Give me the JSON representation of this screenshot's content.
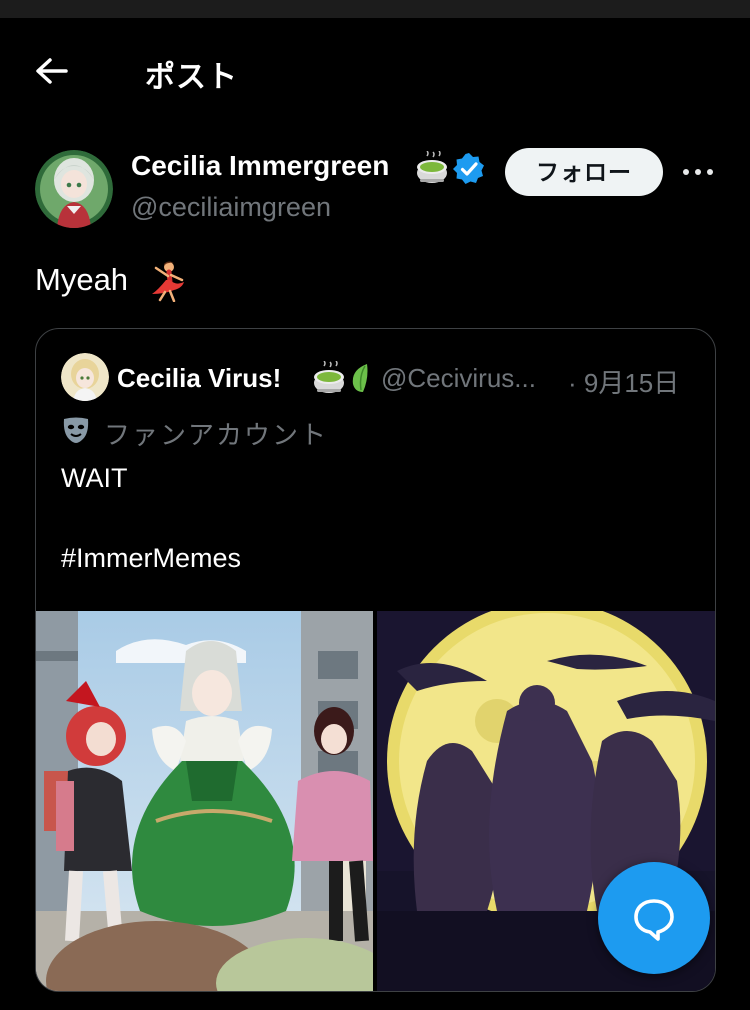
{
  "header": {
    "title": "ポスト",
    "back_icon": "arrow-left-icon"
  },
  "post": {
    "display_name": "Cecilia Immergreen",
    "name_emoji": "matcha-tea-emoji",
    "verified_badge": "verified-icon",
    "handle": "@ceciliaimgreen",
    "follow_label": "フォロー",
    "more_icon": "more-horizontal-icon",
    "text": "Myeah",
    "text_emoji": "dancer-emoji"
  },
  "quote": {
    "display_name": "Cecilia Virus!",
    "name_emojis": [
      "matcha-tea-emoji",
      "green-leaf-emoji"
    ],
    "handle": "@Cecivirus...",
    "date": "· 9月15日",
    "label_icon": "mask-icon",
    "label": "ファンアカウント",
    "text_line1": "WAIT",
    "text_line2": "#ImmerMemes",
    "media": [
      "anime-characters-street-image",
      "full-moon-silhouettes-image"
    ]
  },
  "fab": {
    "icon": "reply-bubble-icon"
  },
  "colors": {
    "background": "#000000",
    "primary_text": "#e7e9ea",
    "secondary_text": "#71767b",
    "accent": "#1d9bf0",
    "border": "#3e4144"
  }
}
